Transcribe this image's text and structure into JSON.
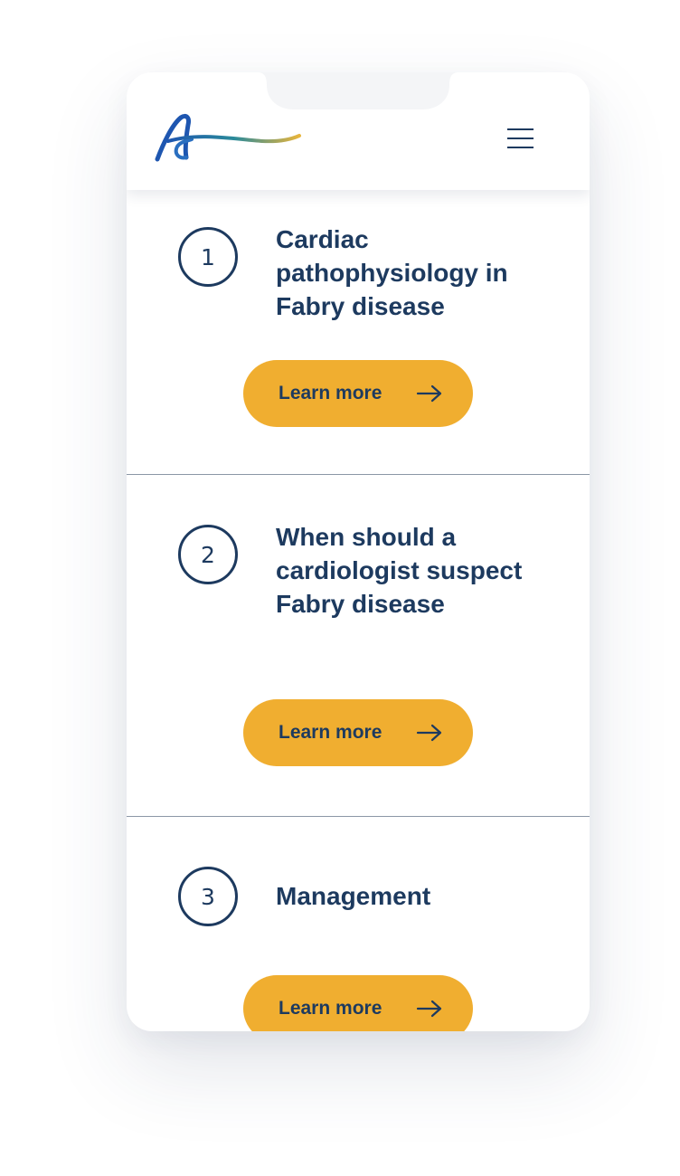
{
  "header": {
    "logo": "brand-swoosh-logo",
    "menu_icon": "hamburger-menu-icon"
  },
  "sections": [
    {
      "number": "1",
      "title": "Cardiac pathophysiology in Fabry disease",
      "button_label": "Learn more",
      "button_icon": "arrow-right-icon"
    },
    {
      "number": "2",
      "title": "When should a cardiologist suspect Fabry disease",
      "button_label": "Learn more",
      "button_icon": "arrow-right-icon"
    },
    {
      "number": "3",
      "title": "Management",
      "button_label": "Learn more",
      "button_icon": "arrow-right-icon"
    }
  ],
  "colors": {
    "navy": "#1d3a5f",
    "accent_yellow": "#f0ae30",
    "divider": "#8b97a6",
    "logo_gradient": [
      "#1e56b0",
      "#2a8a9a",
      "#e8b53c"
    ]
  }
}
